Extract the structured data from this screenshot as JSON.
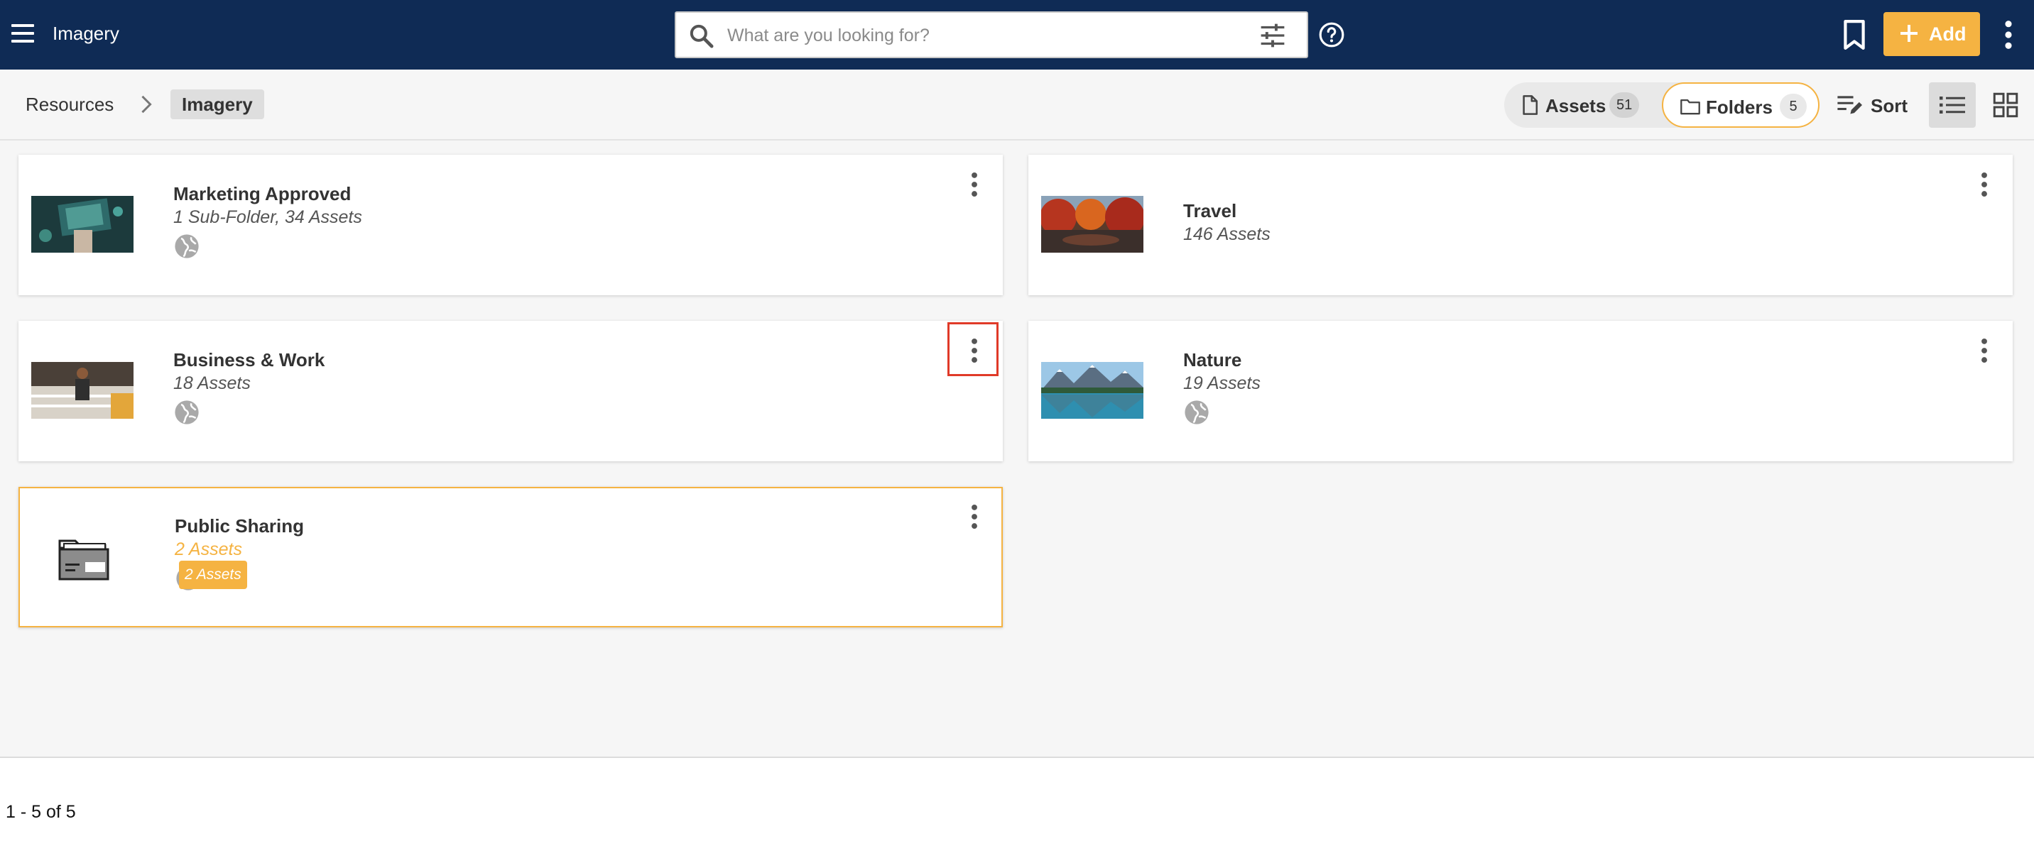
{
  "header": {
    "app_title": "Imagery",
    "search_placeholder": "What are you looking for?",
    "add_label": "Add",
    "colors": {
      "bar": "#0f2b55",
      "accent": "#f5b342"
    }
  },
  "breadcrumb": {
    "root": "Resources",
    "current": "Imagery"
  },
  "toolbar": {
    "assets_label": "Assets",
    "assets_count": "51",
    "folders_label": "Folders",
    "folders_count": "5",
    "sort_label": "Sort",
    "view_modes": [
      "list-icon",
      "grid-icon"
    ],
    "active_view": "list-icon"
  },
  "folders": [
    {
      "name": "Marketing Approved",
      "meta": "1 Sub-Folder, 34 Assets",
      "public": true,
      "thumb": "marketing"
    },
    {
      "name": "Travel",
      "meta": "146 Assets",
      "public": false,
      "thumb": "travel"
    },
    {
      "name": "Business & Work",
      "meta": "18 Assets",
      "public": true,
      "thumb": "business"
    },
    {
      "name": "Nature",
      "meta": "19 Assets",
      "public": true,
      "thumb": "nature"
    },
    {
      "name": "Public Sharing",
      "meta": "2 Assets",
      "public": true,
      "thumb": "folder-icon",
      "selected": true
    }
  ],
  "tooltip": "2 Assets",
  "pagination": {
    "range": "1 - 5 of 5"
  }
}
